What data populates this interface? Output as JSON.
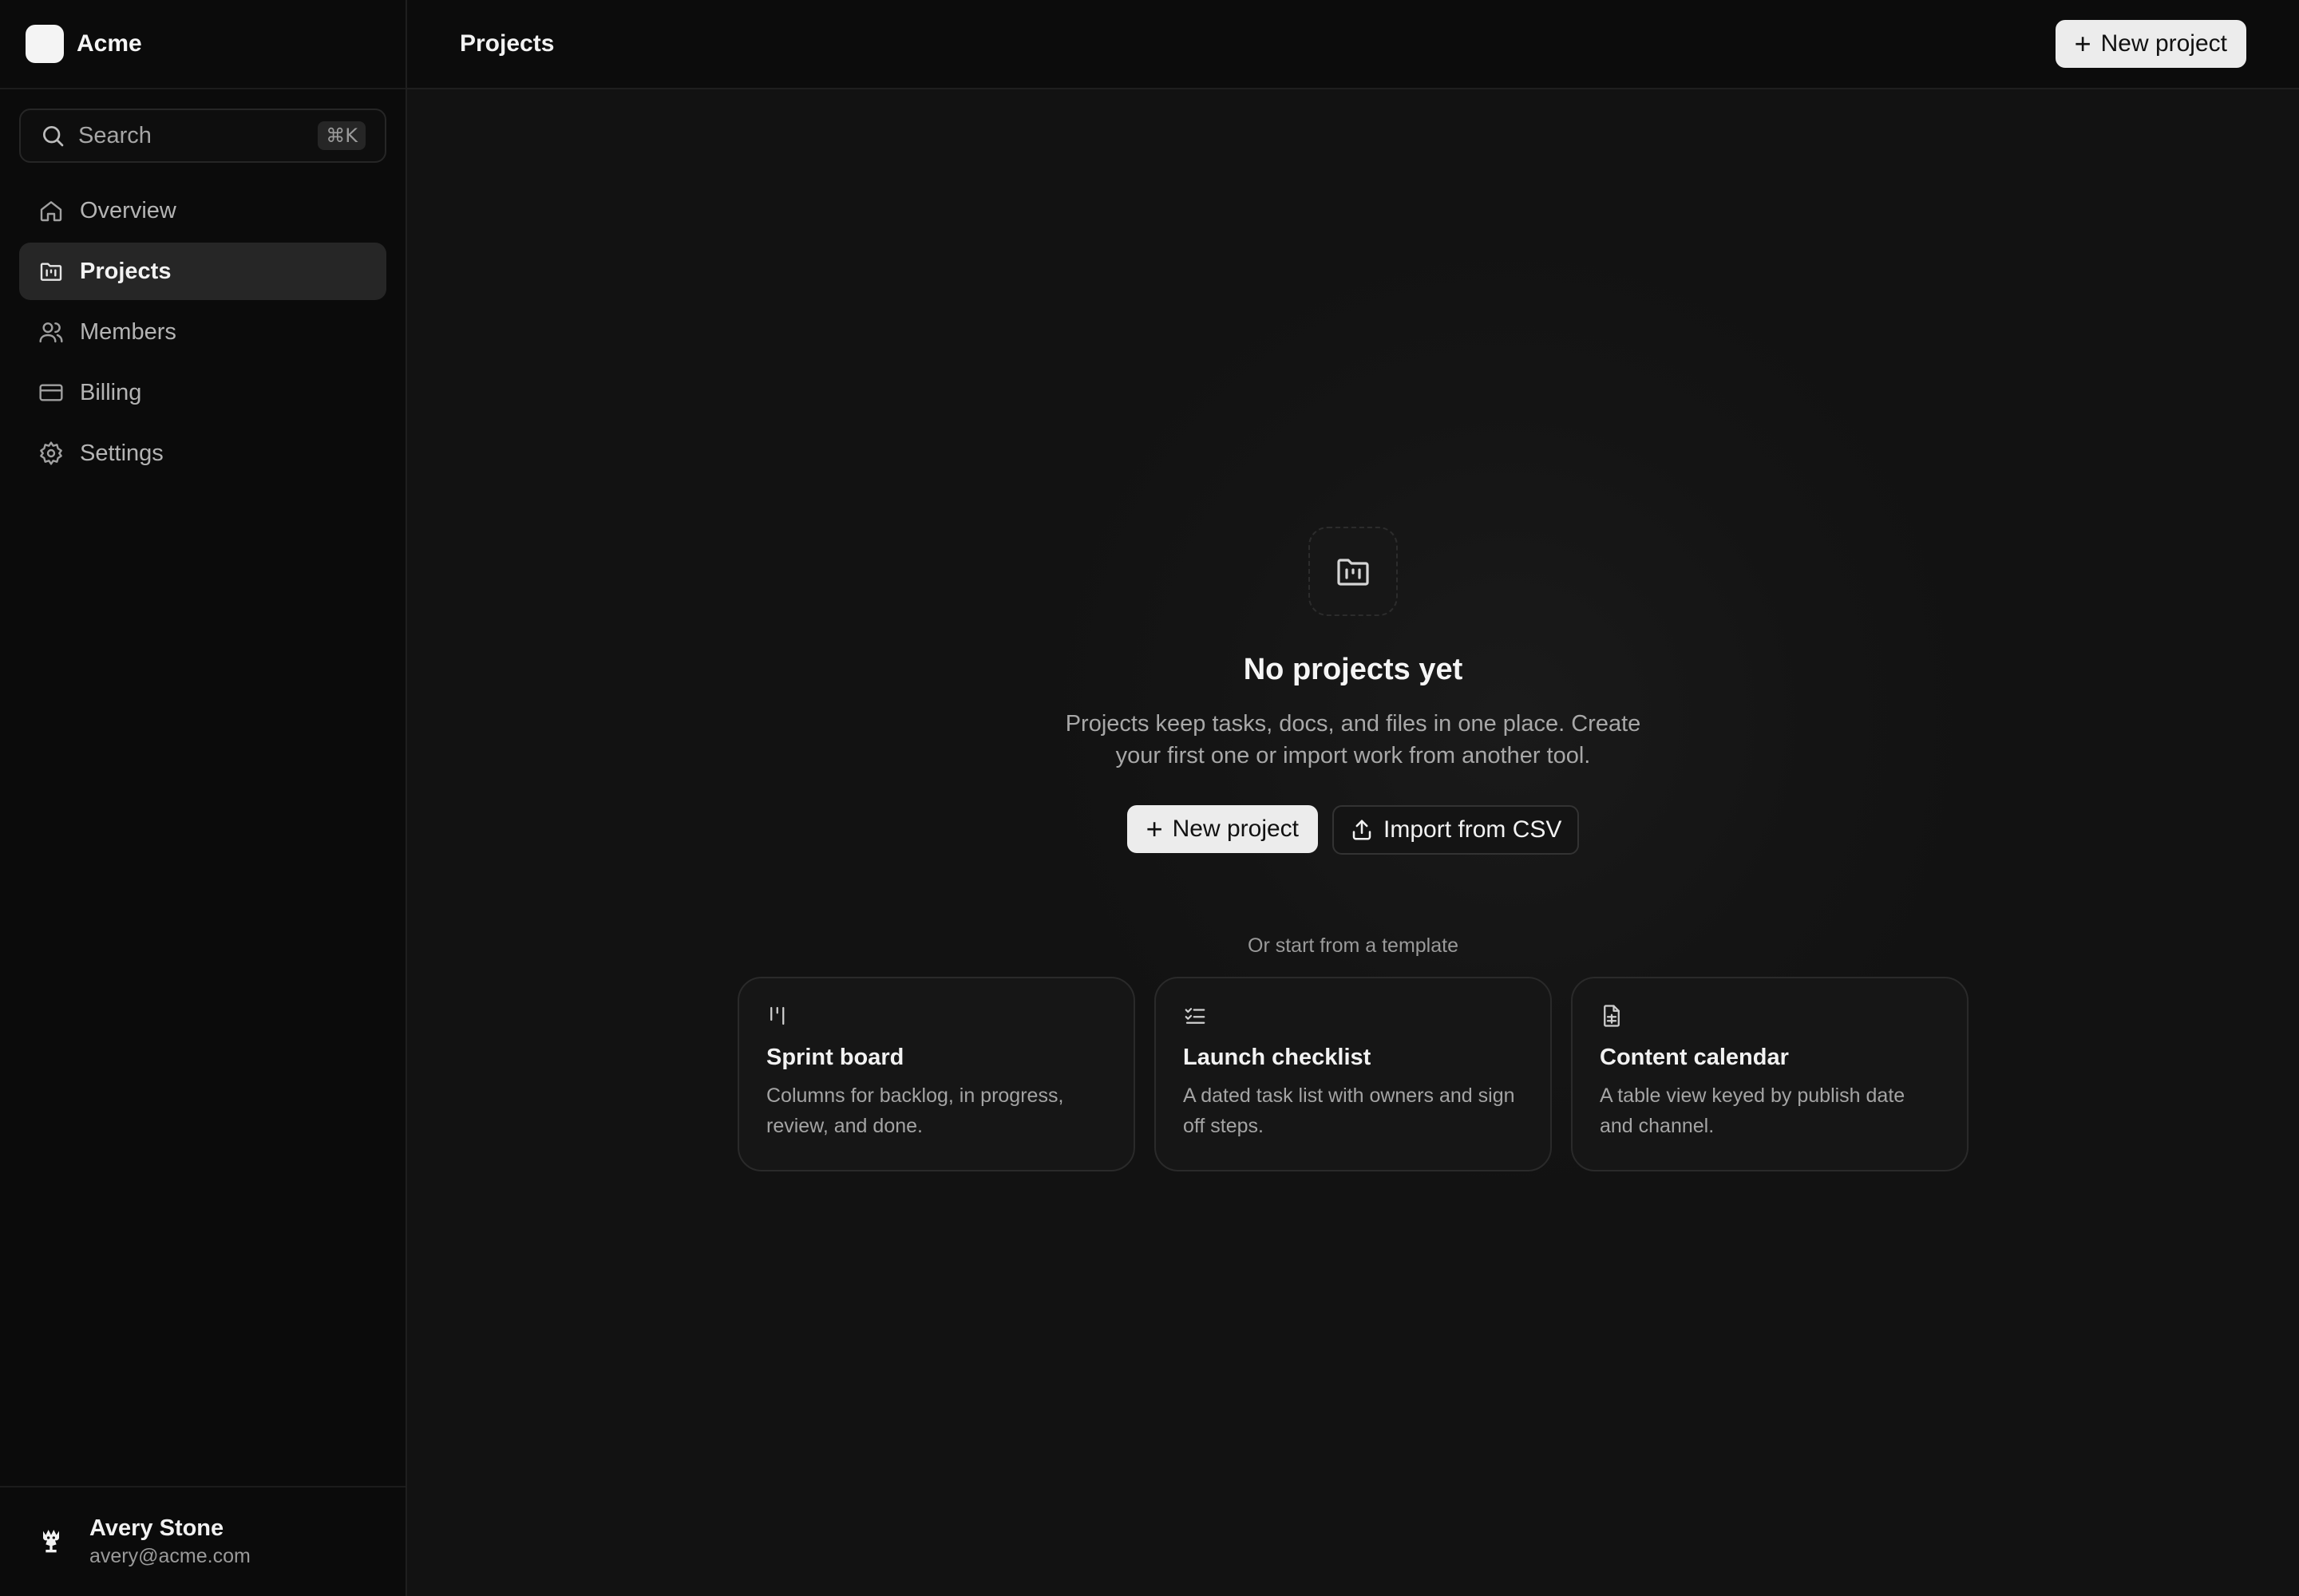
{
  "brand": {
    "name": "Acme"
  },
  "search": {
    "label": "Search",
    "shortcut": "⌘K"
  },
  "nav": {
    "items": [
      {
        "label": "Overview",
        "icon": "home-icon"
      },
      {
        "label": "Projects",
        "icon": "folder-kanban-icon",
        "active": true
      },
      {
        "label": "Members",
        "icon": "users-icon"
      },
      {
        "label": "Billing",
        "icon": "credit-card-icon"
      },
      {
        "label": "Settings",
        "icon": "gear-icon"
      }
    ]
  },
  "user": {
    "name": "Avery Stone",
    "email": "avery@acme.com"
  },
  "header": {
    "title": "Projects",
    "new_project_label": "New project"
  },
  "empty_state": {
    "title": "No projects yet",
    "description": "Projects keep tasks, docs, and files in one place. Create your first one or import work from another tool.",
    "primary_label": "New project",
    "secondary_label": "Import from CSV"
  },
  "templates": {
    "label": "Or start from a template",
    "items": [
      {
        "title": "Sprint board",
        "description": "Columns for backlog, in progress, review, and done.",
        "icon": "kanban-icon"
      },
      {
        "title": "Launch checklist",
        "description": "A dated task list with owners and sign off steps.",
        "icon": "checklist-icon"
      },
      {
        "title": "Content calendar",
        "description": "A table view keyed by publish date and channel.",
        "icon": "document-icon"
      }
    ]
  }
}
